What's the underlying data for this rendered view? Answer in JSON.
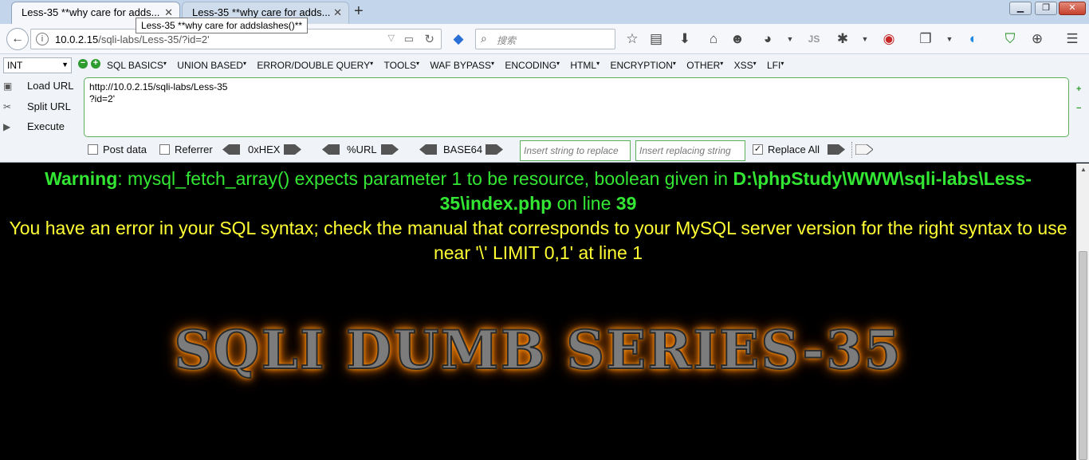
{
  "tabs": [
    {
      "label": "Less-35 **why care for adds...",
      "close": "✕"
    },
    {
      "label": "Less-35 **why care for adds...",
      "close": "✕"
    }
  ],
  "new_tab": "+",
  "tooltip": "Less-35 **why care for addslashes()**",
  "window": {
    "min": "▁",
    "max": "❐",
    "close": "✕"
  },
  "nav": {
    "url_host": "10.0.2.15",
    "url_rest": "/sqli-labs/Less-35/?id=2'",
    "search_placeholder": "搜索"
  },
  "hackbar": {
    "type_select": "INT",
    "menu": [
      "SQL BASICS",
      "UNION BASED",
      "ERROR/DOUBLE QUERY",
      "TOOLS",
      "WAF BYPASS",
      "ENCODING",
      "HTML",
      "ENCRYPTION",
      "OTHER",
      "XSS",
      "LFI"
    ],
    "actions": {
      "load": "Load URL",
      "split": "Split URL",
      "execute": "Execute"
    },
    "url_value": "http://10.0.2.15/sqli-labs/Less-35\n?id=2'",
    "post_data": "Post data",
    "referrer": "Referrer",
    "hex": "0xHEX",
    "url_enc": "%URL",
    "base64": "BASE64",
    "insert_placeholder": "Insert string to replace",
    "replacing_placeholder": "Insert replacing string",
    "replace_all": "Replace All",
    "replace_all_checked": "✓"
  },
  "page": {
    "warning_label": "Warning",
    "warning_text": ": mysql_fetch_array() expects parameter 1 to be resource, boolean given in ",
    "warning_path": "D:\\phpStudy\\WWW\\sqli-labs\\Less-35\\index.php",
    "warning_online": " on line ",
    "warning_line": "39",
    "sql_error": "You have an error in your SQL syntax; check the manual that corresponds to your MySQL server version for the right syntax to use near '\\' LIMIT 0,1' at line 1",
    "banner": "SQLI DUMB SERIES-35"
  },
  "colors": {
    "warning": "#33e633",
    "sql_error": "#ffff33",
    "banner_glow": "#ff8c00"
  }
}
